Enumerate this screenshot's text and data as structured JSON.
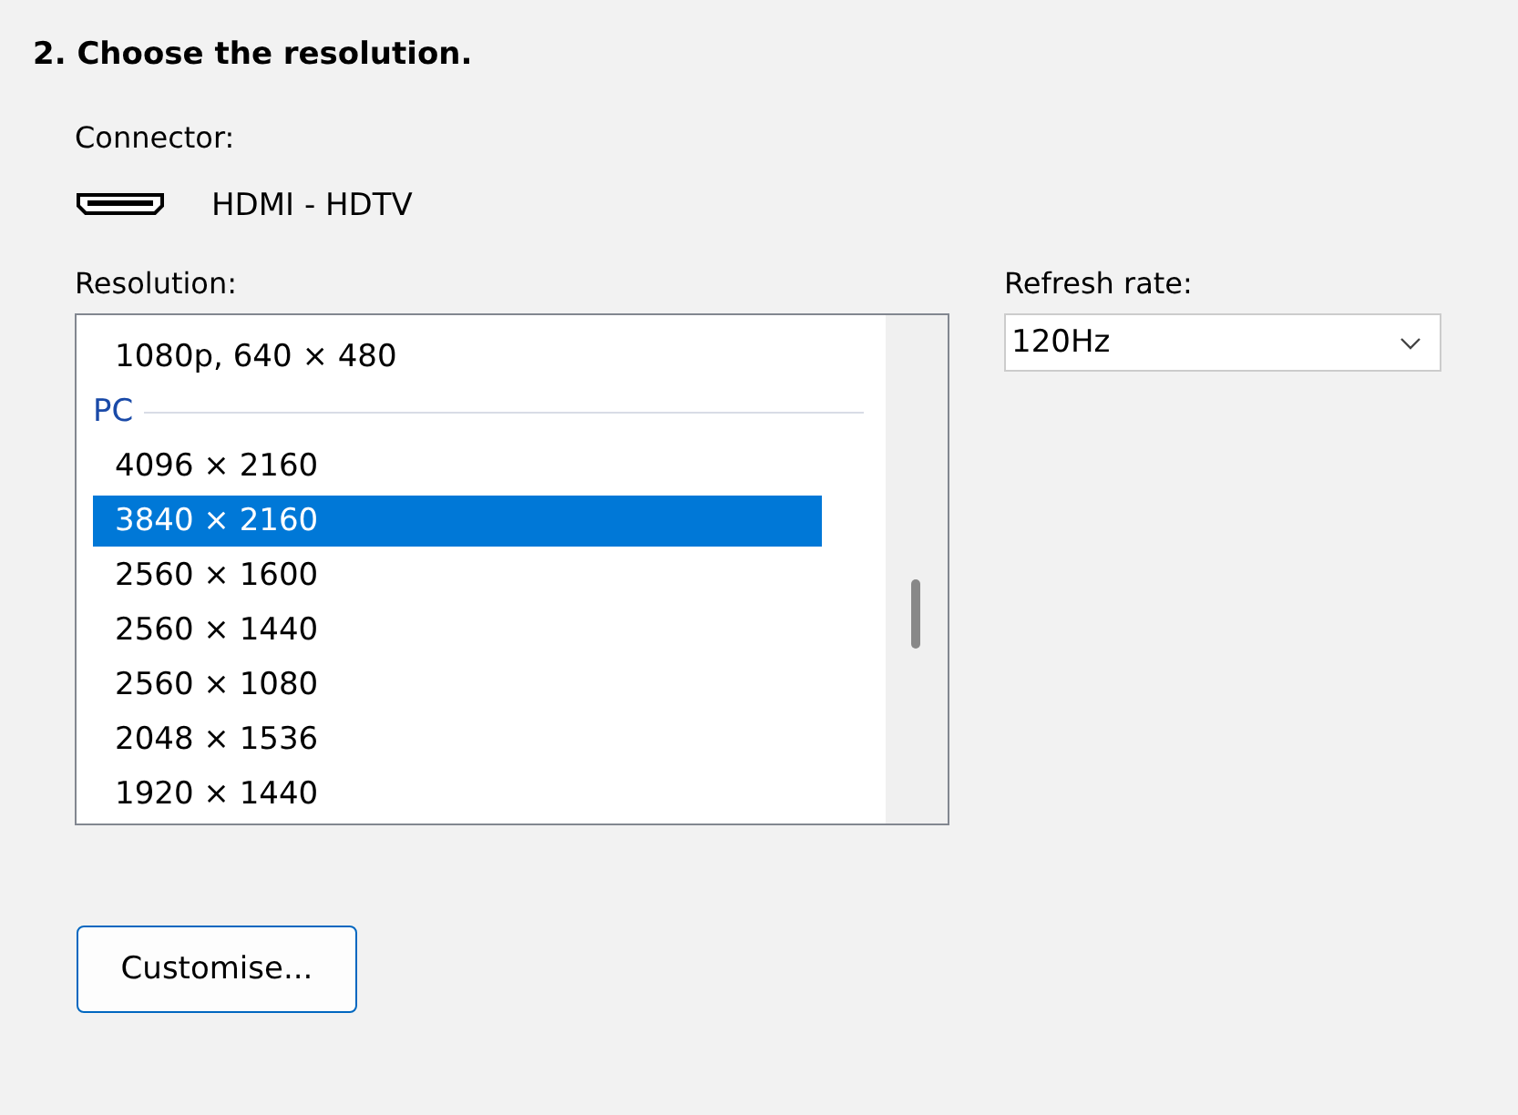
{
  "heading": "2. Choose the resolution.",
  "connector": {
    "label": "Connector:",
    "value": "HDMI - HDTV"
  },
  "resolution": {
    "label": "Resolution:",
    "items": [
      {
        "kind": "item",
        "text": "1080p, 640 × 480",
        "selected": false
      },
      {
        "kind": "header",
        "text": "PC"
      },
      {
        "kind": "item",
        "text": "4096 × 2160",
        "selected": false
      },
      {
        "kind": "item",
        "text": "3840 × 2160",
        "selected": true
      },
      {
        "kind": "item",
        "text": "2560 × 1600",
        "selected": false
      },
      {
        "kind": "item",
        "text": "2560 × 1440",
        "selected": false
      },
      {
        "kind": "item",
        "text": "2560 × 1080",
        "selected": false
      },
      {
        "kind": "item",
        "text": "2048 × 1536",
        "selected": false
      },
      {
        "kind": "item",
        "text": "1920 × 1440",
        "selected": false
      }
    ]
  },
  "refresh": {
    "label": "Refresh rate:",
    "value": "120Hz"
  },
  "button": "Customise..."
}
